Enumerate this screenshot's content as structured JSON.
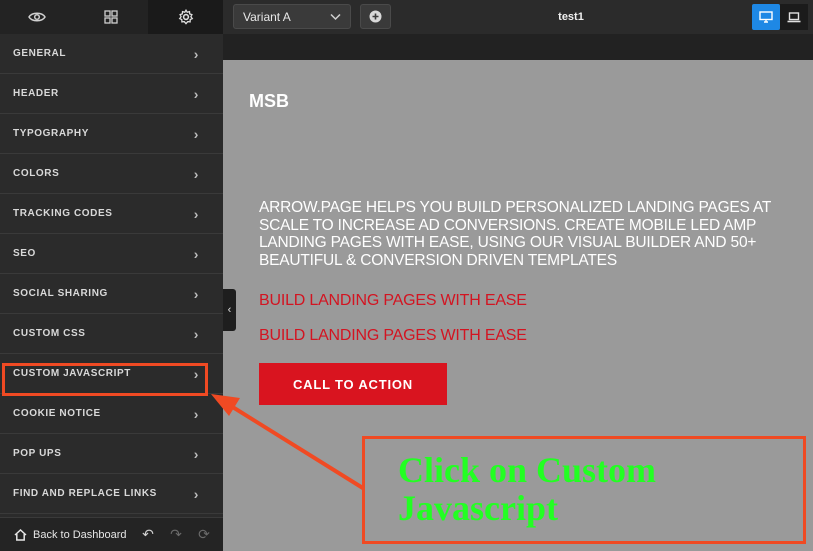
{
  "sidebar": {
    "tabs": [
      {
        "icon": "eye-icon"
      },
      {
        "icon": "grid-icon"
      },
      {
        "icon": "gear-icon"
      }
    ],
    "items": [
      {
        "label": "General"
      },
      {
        "label": "Header"
      },
      {
        "label": "Typography"
      },
      {
        "label": "Colors"
      },
      {
        "label": "Tracking Codes"
      },
      {
        "label": "SEO"
      },
      {
        "label": "Social Sharing"
      },
      {
        "label": "Custom CSS"
      },
      {
        "label": "Custom Javascript"
      },
      {
        "label": "Cookie Notice"
      },
      {
        "label": "Pop Ups"
      },
      {
        "label": "Find and Replace Links"
      }
    ],
    "footer": {
      "back_label": "Back to Dashboard"
    }
  },
  "topbar": {
    "variant": "Variant A",
    "page_name": "test1"
  },
  "page": {
    "brand": "MSB",
    "hero": "ARROW.PAGE HELPS YOU BUILD PERSONALIZED LANDING PAGES AT SCALE TO INCREASE AD CONVERSIONS. CREATE MOBILE LED AMP LANDING PAGES WITH EASE, USING OUR VISUAL BUILDER AND 50+ BEAUTIFUL & CONVERSION DRIVEN TEMPLATES",
    "line1": "BUILD LANDING PAGES WITH EASE",
    "line2": "BUILD LANDING PAGES WITH EASE",
    "cta": "CALL TO ACTION"
  },
  "annotation": {
    "callout": "Click on Custom Javascript",
    "color": "#f04a23",
    "text_color": "#22ff22"
  }
}
